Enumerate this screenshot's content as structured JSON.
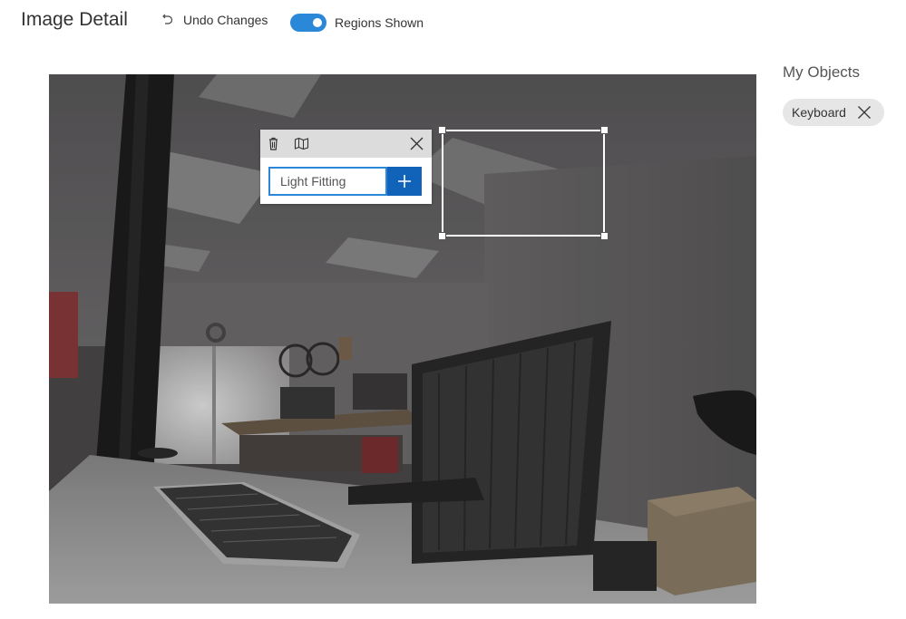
{
  "header": {
    "title": "Image Detail",
    "undo_label": "Undo Changes",
    "undo_icon": "undo-icon",
    "toggle_label": "Regions Shown",
    "toggle_on": true,
    "accent_color": "#2b88d8"
  },
  "popup": {
    "tag_input_value": "Light Fitting",
    "icons": [
      "trash-icon",
      "map-icon",
      "close-icon",
      "plus-icon"
    ],
    "add_button_color": "#1063b9"
  },
  "sidebar": {
    "title": "My Objects",
    "objects": [
      {
        "label": "Keyboard",
        "icon": "close-icon"
      }
    ]
  }
}
